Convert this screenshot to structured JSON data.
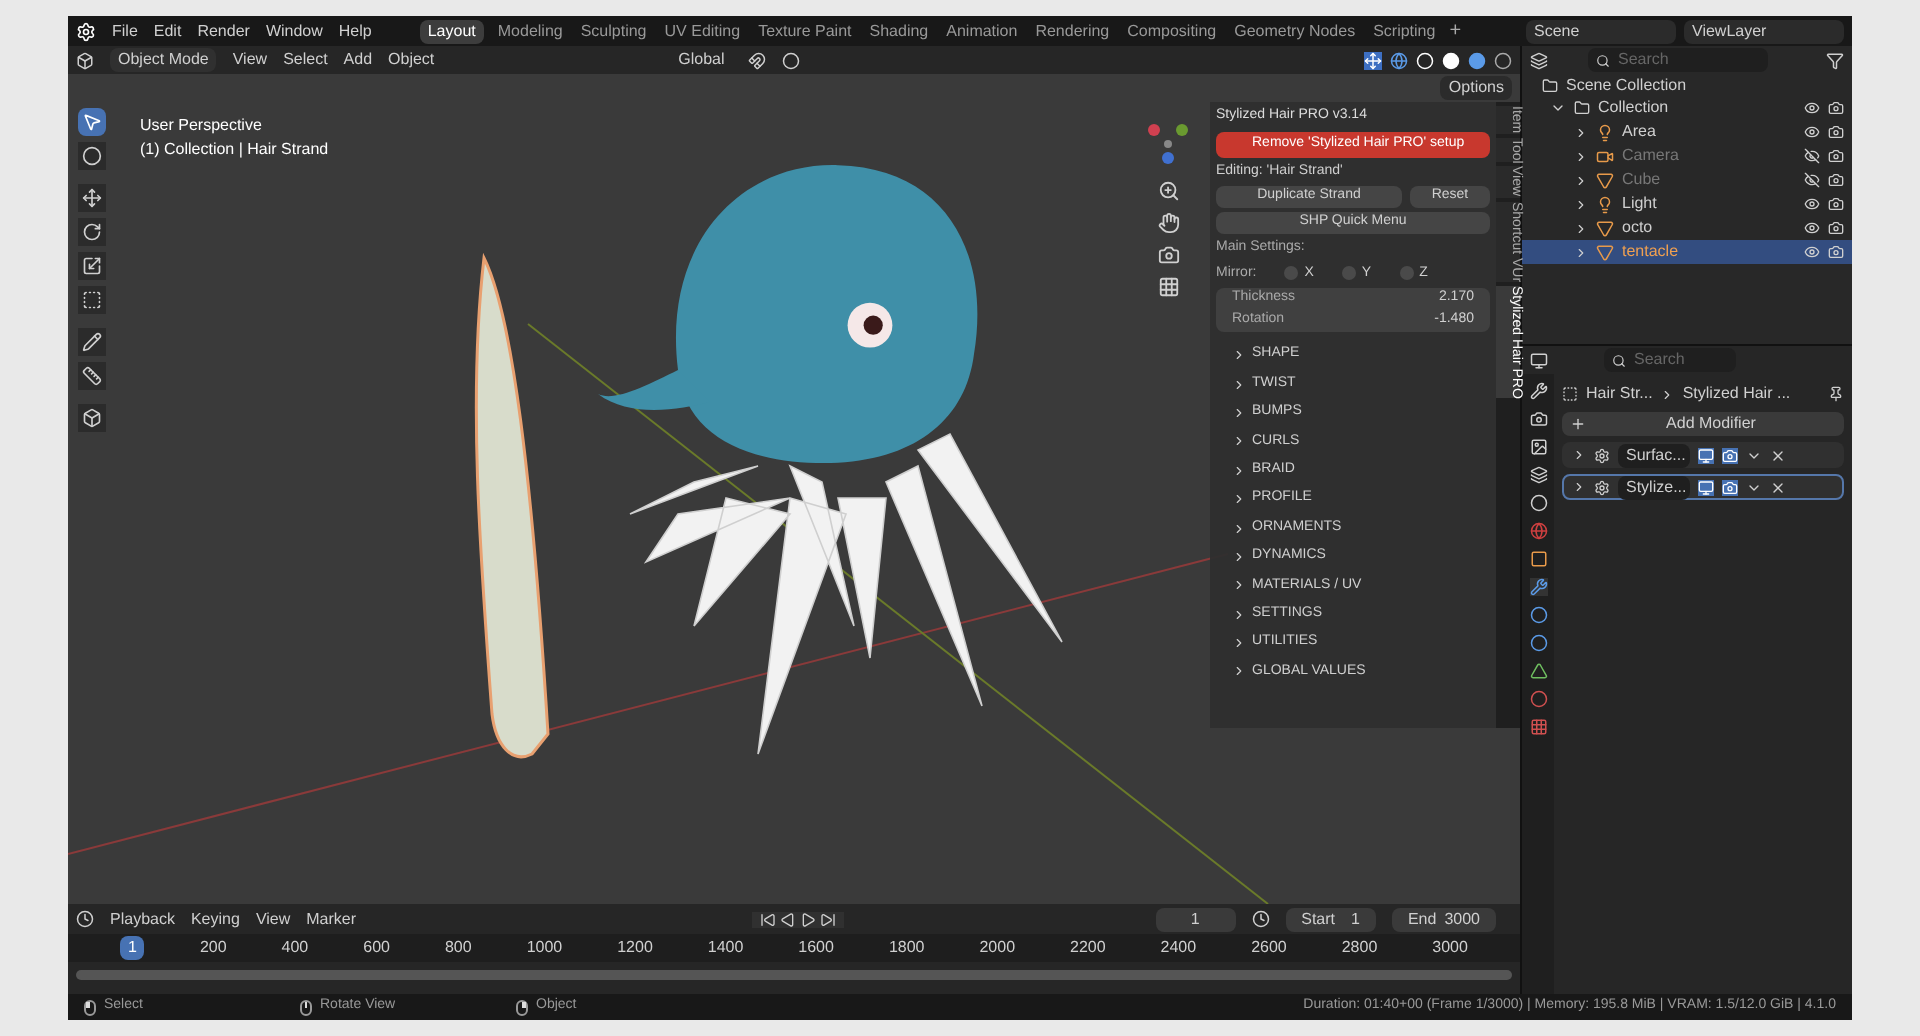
{
  "topbar": {
    "menus": [
      "File",
      "Edit",
      "Render",
      "Window",
      "Help"
    ],
    "workspaces": [
      {
        "label": "Layout",
        "selected": true
      },
      {
        "label": "Modeling",
        "selected": false
      },
      {
        "label": "Sculpting",
        "selected": false
      },
      {
        "label": "UV Editing",
        "selected": false
      },
      {
        "label": "Texture Paint",
        "selected": false
      },
      {
        "label": "Shading",
        "selected": false
      },
      {
        "label": "Animation",
        "selected": false
      },
      {
        "label": "Rendering",
        "selected": false
      },
      {
        "label": "Compositing",
        "selected": false
      },
      {
        "label": "Geometry Nodes",
        "selected": false
      },
      {
        "label": "Scripting",
        "selected": false
      }
    ],
    "add_tab": "+",
    "scene": "Scene",
    "view_layer": "ViewLayer"
  },
  "viewport_header": {
    "mode": "Object Mode",
    "menus": [
      "View",
      "Select",
      "Add",
      "Object"
    ],
    "orientation": "Global",
    "options": "Options"
  },
  "viewport": {
    "overlay_lines": [
      "User Perspective",
      "(1) Collection | Hair Strand"
    ]
  },
  "n_panel": {
    "title": "Stylized Hair PRO v3.14",
    "remove_button": "Remove 'Stylized Hair PRO' setup",
    "editing": "Editing:  'Hair Strand'",
    "duplicate_button": "Duplicate Strand",
    "reset_button": "Reset",
    "quick_menu_button": "SHP Quick Menu",
    "main_settings": "Main Settings:",
    "mirror_label": "Mirror:",
    "mirror_axes": [
      {
        "label": "X",
        "checked": false
      },
      {
        "label": "Y",
        "checked": false
      },
      {
        "label": "Z",
        "checked": false
      }
    ],
    "fields": [
      {
        "label": "Thickness",
        "value": "2.170"
      },
      {
        "label": "Rotation",
        "value": "-1.480"
      }
    ],
    "sections": [
      {
        "label": "SHAPE",
        "expanded": false
      },
      {
        "label": "TWIST",
        "expanded": false
      },
      {
        "label": "BUMPS",
        "expanded": false
      },
      {
        "label": "CURLS",
        "expanded": false
      },
      {
        "label": "BRAID",
        "expanded": false
      },
      {
        "label": "PROFILE",
        "expanded": false
      },
      {
        "label": "ORNAMENTS",
        "expanded": false
      },
      {
        "label": "DYNAMICS",
        "expanded": false
      },
      {
        "label": "MATERIALS / UV",
        "expanded": false
      },
      {
        "label": "SETTINGS",
        "expanded": false
      },
      {
        "label": "UTILITIES",
        "expanded": false
      },
      {
        "label": "GLOBAL VALUES",
        "expanded": false
      }
    ],
    "tabs": [
      {
        "label": "Item",
        "selected": false
      },
      {
        "label": "Tool",
        "selected": false
      },
      {
        "label": "View",
        "selected": false
      },
      {
        "label": "Shortcut VUr",
        "selected": false
      },
      {
        "label": "Stylized Hair PRO",
        "selected": true
      }
    ]
  },
  "outliner": {
    "search_placeholder": "Search",
    "root": "Scene Collection",
    "collection": {
      "label": "Collection",
      "expanded": true,
      "children": [
        {
          "label": "Area",
          "kind": "light",
          "visible": true,
          "selected": false
        },
        {
          "label": "Camera",
          "kind": "camera",
          "visible": false,
          "selected": false
        },
        {
          "label": "Cube",
          "kind": "mesh",
          "visible": false,
          "selected": false
        },
        {
          "label": "Light",
          "kind": "light",
          "visible": true,
          "selected": false
        },
        {
          "label": "octo",
          "kind": "mesh",
          "visible": true,
          "selected": false
        },
        {
          "label": "tentacle",
          "kind": "mesh",
          "visible": true,
          "selected": true
        }
      ]
    }
  },
  "properties": {
    "search_placeholder": "Search",
    "breadcrumb": [
      "Hair Str...",
      "Stylized Hair ..."
    ],
    "add_modifier": "Add Modifier",
    "modifiers": [
      {
        "name": "Surfac...",
        "selected": false
      },
      {
        "name": "Stylize...",
        "selected": true
      }
    ]
  },
  "timeline": {
    "menus": [
      "Playback",
      "Keying",
      "View",
      "Marker"
    ],
    "current_frame": "1",
    "start_label": "Start",
    "start": "1",
    "end_label": "End",
    "end": "3000",
    "ticks": [
      {
        "label": "1",
        "current": true
      },
      {
        "label": "200",
        "current": false
      },
      {
        "label": "400",
        "current": false
      },
      {
        "label": "600",
        "current": false
      },
      {
        "label": "800",
        "current": false
      },
      {
        "label": "1000",
        "current": false
      },
      {
        "label": "1200",
        "current": false
      },
      {
        "label": "1400",
        "current": false
      },
      {
        "label": "1600",
        "current": false
      },
      {
        "label": "1800",
        "current": false
      },
      {
        "label": "2000",
        "current": false
      },
      {
        "label": "2200",
        "current": false
      },
      {
        "label": "2400",
        "current": false
      },
      {
        "label": "2600",
        "current": false
      },
      {
        "label": "2800",
        "current": false
      },
      {
        "label": "3000",
        "current": false
      }
    ]
  },
  "status_bar": {
    "hints": [
      {
        "kind": "left",
        "label": "Select"
      },
      {
        "kind": "middle",
        "label": "Rotate View"
      },
      {
        "kind": "right",
        "label": "Object"
      }
    ],
    "info": "Duration: 01:40+00 (Frame 1/3000) | Memory: 195.8 MiB | VRAM: 1.5/12.0 GiB | 4.1.0"
  }
}
